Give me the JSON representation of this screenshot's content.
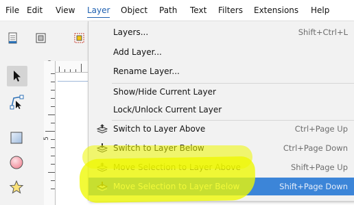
{
  "menubar": {
    "items": [
      "File",
      "Edit",
      "View",
      "Layer",
      "Object",
      "Path",
      "Text",
      "Filters",
      "Extensions",
      "Help"
    ],
    "active_index": 3
  },
  "toolbar": {
    "tools": [
      "selector-arrow-icon",
      "node-editor-icon",
      "rectangle-icon",
      "ellipse-icon",
      "star-icon"
    ],
    "selected_index": 0
  },
  "ruler": {
    "vertical_label": "5"
  },
  "layer_menu": {
    "items": [
      {
        "label": "Layers...",
        "shortcut": "Shift+Ctrl+L",
        "icon": ""
      },
      {
        "label": "Add Layer...",
        "shortcut": "",
        "icon": ""
      },
      {
        "label": "Rename Layer...",
        "shortcut": "",
        "icon": ""
      },
      {
        "label": "Show/Hide Current Layer",
        "shortcut": "",
        "icon": ""
      },
      {
        "label": "Lock/Unlock Current Layer",
        "shortcut": "",
        "icon": ""
      },
      {
        "label": "Switch to Layer Above",
        "shortcut": "Ctrl+Page Up",
        "icon": "layer-up-icon"
      },
      {
        "label": "Switch to Layer Below",
        "shortcut": "Ctrl+Page Down",
        "icon": "layer-down-icon"
      },
      {
        "label": "Move Selection to Layer Above",
        "shortcut": "Shift+Page Up",
        "icon": "move-selection-up-icon"
      },
      {
        "label": "Move Selection to Layer Below",
        "shortcut": "Shift+Page Down",
        "icon": "move-selection-down-icon"
      }
    ],
    "highlighted_index": 8
  },
  "colors": {
    "highlight": "#3c85d8",
    "marker": "#eef800",
    "active_menu": "#1c5fb0"
  }
}
